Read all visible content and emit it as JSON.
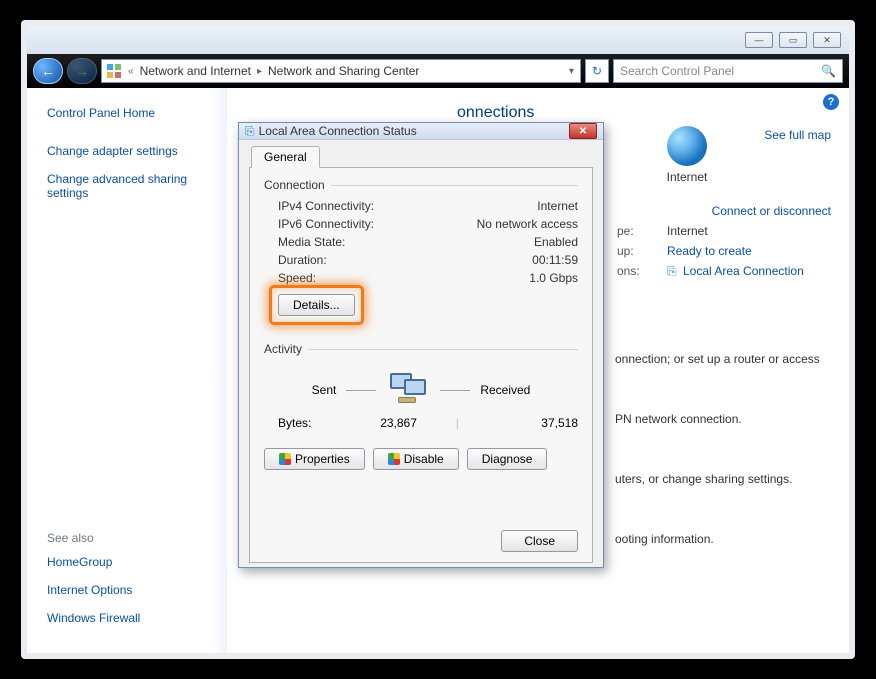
{
  "window_buttons": {
    "min": "—",
    "max": "▭",
    "close": "✕"
  },
  "address": {
    "crumb1": "Network and Internet",
    "crumb2": "Network and Sharing Center"
  },
  "search": {
    "placeholder": "Search Control Panel"
  },
  "sidebar": {
    "home": "Control Panel Home",
    "links": [
      "Change adapter settings",
      "Change advanced sharing settings"
    ],
    "see_also_title": "See also",
    "see_also": [
      "HomeGroup",
      "Internet Options",
      "Windows Firewall"
    ]
  },
  "heading": "onnections",
  "internet_label": "Internet",
  "map_link": "See full map",
  "connect_link": "Connect or disconnect",
  "info": {
    "type_k": "pe:",
    "type_v": "Internet",
    "group_k": "up:",
    "group_v": "Ready to create",
    "conn_k": "ons:",
    "conn_v": "Local Area Connection"
  },
  "body_lines": [
    "onnection; or set up a router or access",
    "PN network connection.",
    "uters, or change sharing settings.",
    "ooting information."
  ],
  "dlg": {
    "title": "Local Area Connection Status",
    "tab": "General",
    "grp_conn": "Connection",
    "rows": {
      "ipv4_k": "IPv4 Connectivity:",
      "ipv4_v": "Internet",
      "ipv6_k": "IPv6 Connectivity:",
      "ipv6_v": "No network access",
      "media_k": "Media State:",
      "media_v": "Enabled",
      "dur_k": "Duration:",
      "dur_v": "00:11:59",
      "speed_k": "Speed:",
      "speed_v": "1.0 Gbps"
    },
    "details_btn": "Details...",
    "grp_activity": "Activity",
    "sent_label": "Sent",
    "recv_label": "Received",
    "bytes_label": "Bytes:",
    "bytes_sent": "23,867",
    "bytes_recv": "37,518",
    "btn_props": "Properties",
    "btn_disable": "Disable",
    "btn_diag": "Diagnose",
    "btn_close": "Close"
  }
}
